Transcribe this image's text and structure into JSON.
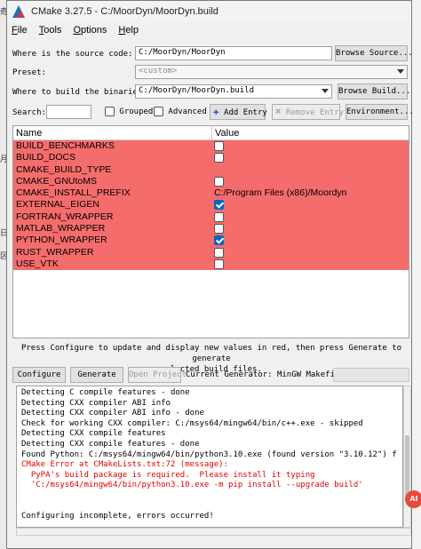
{
  "window": {
    "title": "CMake 3.27.5 - C:/MoorDyn/MoorDyn.build",
    "background_chars": [
      "奇",
      "月",
      "日",
      "区"
    ]
  },
  "menu": [
    "File",
    "Tools",
    "Options",
    "Help"
  ],
  "source": {
    "label": "Where is the source code:",
    "value": "C:/MoorDyn/MoorDyn",
    "browse_label": "Browse Source..."
  },
  "preset": {
    "label": "Preset:",
    "value": "<custom>"
  },
  "build": {
    "label": "Where to build the binaries:",
    "value": "C:/MoorDyn/MoorDyn.build",
    "browse_label": "Browse Build..."
  },
  "toolbar": {
    "search_label": "Search:",
    "search_value": "",
    "grouped_label": "Grouped",
    "grouped_checked": false,
    "advanced_label": "Advanced",
    "advanced_checked": false,
    "add_entry_label": "Add Entry",
    "remove_entry_label": "Remove Entry",
    "environment_label": "Environment..."
  },
  "table": {
    "col_name": "Name",
    "col_value": "Value",
    "row_color": "#f56c6c",
    "rows": [
      {
        "name": "BUILD_BENCHMARKS",
        "kind": "bool",
        "checked": false,
        "value": ""
      },
      {
        "name": "BUILD_DOCS",
        "kind": "bool",
        "checked": false,
        "value": ""
      },
      {
        "name": "CMAKE_BUILD_TYPE",
        "kind": "text",
        "checked": false,
        "value": ""
      },
      {
        "name": "CMAKE_GNUtoMS",
        "kind": "bool",
        "checked": false,
        "value": ""
      },
      {
        "name": "CMAKE_INSTALL_PREFIX",
        "kind": "text",
        "checked": false,
        "value": "C:/Program Files (x86)/Moordyn"
      },
      {
        "name": "EXTERNAL_EIGEN",
        "kind": "bool",
        "checked": true,
        "value": ""
      },
      {
        "name": "FORTRAN_WRAPPER",
        "kind": "bool",
        "checked": false,
        "value": ""
      },
      {
        "name": "MATLAB_WRAPPER",
        "kind": "bool",
        "checked": false,
        "value": ""
      },
      {
        "name": "PYTHON_WRAPPER",
        "kind": "bool",
        "checked": true,
        "value": ""
      },
      {
        "name": "RUST_WRAPPER",
        "kind": "bool",
        "checked": false,
        "value": ""
      },
      {
        "name": "USE_VTK",
        "kind": "bool",
        "checked": false,
        "value": ""
      }
    ]
  },
  "hint": {
    "line1": "Press Configure to update and display new values in red, then press Generate to generate",
    "line2": "selected build files."
  },
  "actions": {
    "configure_label": "Configure",
    "generate_label": "Generate",
    "open_project_label": "Open Project",
    "generator_text": "Current Generator: MinGW Makefiles"
  },
  "log": {
    "error_color": "#e00000",
    "lines": [
      {
        "text": "Detecting C compile features - done",
        "error": false
      },
      {
        "text": "Detecting CXX compiler ABI info",
        "error": false
      },
      {
        "text": "Detecting CXX compiler ABI info - done",
        "error": false
      },
      {
        "text": "Check for working CXX compiler: C:/msys64/mingw64/bin/c++.exe - skipped",
        "error": false
      },
      {
        "text": "Detecting CXX compile features",
        "error": false
      },
      {
        "text": "Detecting CXX compile features - done",
        "error": false
      },
      {
        "text": "Found Python: C:/msys64/mingw64/bin/python3.10.exe (found version \"3.10.12\") f",
        "error": false
      },
      {
        "text": "CMake Error at CMakeLists.txt:72 (message):",
        "error": true
      },
      {
        "text": "  PyPA's build package is required.  Please install it typing",
        "error": true
      },
      {
        "text": "  'C:/msys64/mingw64/bin/python3.10.exe -m pip install --upgrade build'",
        "error": true
      },
      {
        "text": "",
        "error": false
      },
      {
        "text": "",
        "error": false
      },
      {
        "text": "Configuring incomplete, errors occurred!",
        "error": false
      }
    ]
  }
}
